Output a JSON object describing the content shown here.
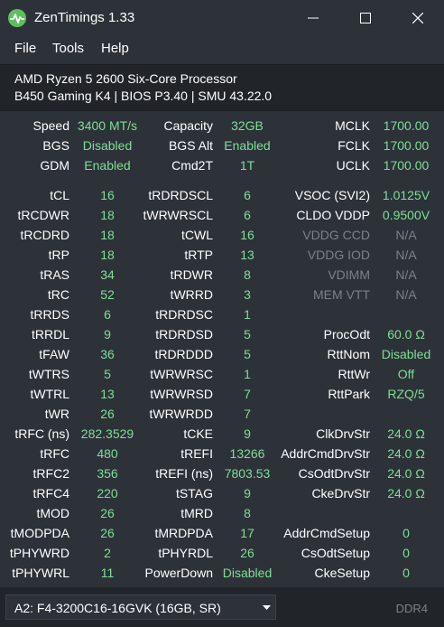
{
  "window": {
    "title": "ZenTimings 1.33",
    "icon": "pulse-icon",
    "controls": [
      "minimize-icon",
      "maximize-icon",
      "close-icon"
    ]
  },
  "menu": {
    "file": "File",
    "tools": "Tools",
    "help": "Help",
    "screenshot_icon": "camera-icon"
  },
  "system": {
    "cpu": "AMD Ryzen 5 2600 Six-Core Processor",
    "board": "B450 Gaming K4 | BIOS P3.40 | SMU 43.22.0"
  },
  "colors": {
    "background": "#2d3239",
    "panel": "#21252a",
    "value": "#7fdf95",
    "disabled": "#7c8188",
    "text": "#ffffff"
  },
  "top": [
    [
      "Speed",
      "3400 MT/s",
      "Capacity",
      "32GB",
      "MCLK",
      "1700.00"
    ],
    [
      "BGS",
      "Disabled",
      "BGS Alt",
      "Enabled",
      "FCLK",
      "1700.00"
    ],
    [
      "GDM",
      "Enabled",
      "Cmd2T",
      "1T",
      "UCLK",
      "1700.00"
    ]
  ],
  "timings": [
    [
      "tCL",
      "16",
      "tRDRDSCL",
      "6",
      "VSOC (SVI2)",
      "1.0125V"
    ],
    [
      "tRCDWR",
      "18",
      "tWRWRSCL",
      "6",
      "CLDO VDDP",
      "0.9500V"
    ],
    [
      "tRCDRD",
      "18",
      "tCWL",
      "16",
      "VDDG CCD",
      "N/A"
    ],
    [
      "tRP",
      "18",
      "tRTP",
      "13",
      "VDDG IOD",
      "N/A"
    ],
    [
      "tRAS",
      "34",
      "tRDWR",
      "8",
      "VDIMM",
      "N/A"
    ],
    [
      "tRC",
      "52",
      "tWRRD",
      "3",
      "MEM VTT",
      "N/A"
    ],
    [
      "tRRDS",
      "6",
      "tRDRDSC",
      "1",
      "",
      ""
    ],
    [
      "tRRDL",
      "9",
      "tRDRDSD",
      "5",
      "ProcOdt",
      "60.0 Ω"
    ],
    [
      "tFAW",
      "36",
      "tRDRDDD",
      "5",
      "RttNom",
      "Disabled"
    ],
    [
      "tWTRS",
      "5",
      "tWRWRSC",
      "1",
      "RttWr",
      "Off"
    ],
    [
      "tWTRL",
      "13",
      "tWRWRSD",
      "7",
      "RttPark",
      "RZQ/5"
    ],
    [
      "tWR",
      "26",
      "tWRWRDD",
      "7",
      "",
      ""
    ],
    [
      "tRFC (ns)",
      "282.3529",
      "tCKE",
      "9",
      "ClkDrvStr",
      "24.0 Ω"
    ],
    [
      "tRFC",
      "480",
      "tREFI",
      "13266",
      "AddrCmdDrvStr",
      "24.0 Ω"
    ],
    [
      "tRFC2",
      "356",
      "tREFI (ns)",
      "7803.53",
      "CsOdtDrvStr",
      "24.0 Ω"
    ],
    [
      "tRFC4",
      "220",
      "tSTAG",
      "9",
      "CkeDrvStr",
      "24.0 Ω"
    ],
    [
      "tMOD",
      "26",
      "tMRD",
      "8",
      "",
      ""
    ],
    [
      "tMODPDA",
      "26",
      "tMRDPDA",
      "17",
      "AddrCmdSetup",
      "0"
    ],
    [
      "tPHYWRD",
      "2",
      "tPHYRDL",
      "26",
      "CsOdtSetup",
      "0"
    ],
    [
      "tPHYWRL",
      "11",
      "PowerDown",
      "Disabled",
      "CkeSetup",
      "0"
    ]
  ],
  "disabled_rows": [
    2,
    3,
    4,
    5
  ],
  "footer": {
    "module": "A2: F4-3200C16-16GVK (16GB, SR)",
    "memtype": "DDR4"
  }
}
